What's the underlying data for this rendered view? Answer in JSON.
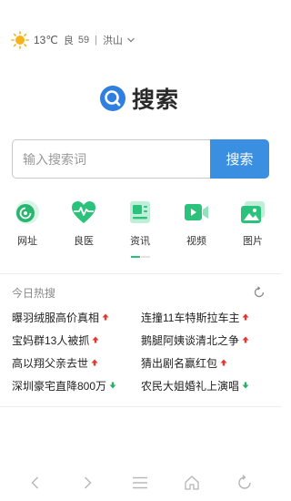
{
  "weather": {
    "icon": "sun-icon",
    "temperature": "13℃",
    "air_quality_label": "良",
    "air_quality_value": "59",
    "separator": "|",
    "city": "洪山"
  },
  "logo": {
    "icon": "search-logo-icon",
    "text": "搜索",
    "color": "#2f7fe0"
  },
  "search": {
    "placeholder": "输入搜索词",
    "button_label": "搜索",
    "button_color": "#3b8fe0"
  },
  "quick_nav": [
    {
      "label": "网址",
      "icon": "globe-icon"
    },
    {
      "label": "良医",
      "icon": "heart-pulse-icon"
    },
    {
      "label": "资讯",
      "icon": "news-icon"
    },
    {
      "label": "视频",
      "icon": "video-icon"
    },
    {
      "label": "图片",
      "icon": "image-icon"
    }
  ],
  "hot": {
    "title": "今日热搜",
    "refresh_icon": "refresh-icon",
    "rows": [
      [
        {
          "text": "曝羽绒服高价真相",
          "trend": "up"
        },
        {
          "text": "连撞11车特斯拉车主",
          "trend": "up"
        }
      ],
      [
        {
          "text": "宝妈群13人被抓",
          "trend": "up"
        },
        {
          "text": "鹅腿阿姨谈清北之争",
          "trend": "up"
        }
      ],
      [
        {
          "text": "高以翔父亲去世",
          "trend": "up"
        },
        {
          "text": "猜出剧名赢红包",
          "trend": "up"
        }
      ],
      [
        {
          "text": "深圳豪宅直降800万",
          "trend": "down"
        },
        {
          "text": "农民大姐婚礼上演唱",
          "trend": "down"
        }
      ]
    ],
    "up_color": "#e5352d",
    "down_color": "#2bb061"
  },
  "bottom_nav": [
    "back-icon",
    "forward-icon",
    "menu-icon",
    "home-icon",
    "refresh-tab-icon"
  ]
}
